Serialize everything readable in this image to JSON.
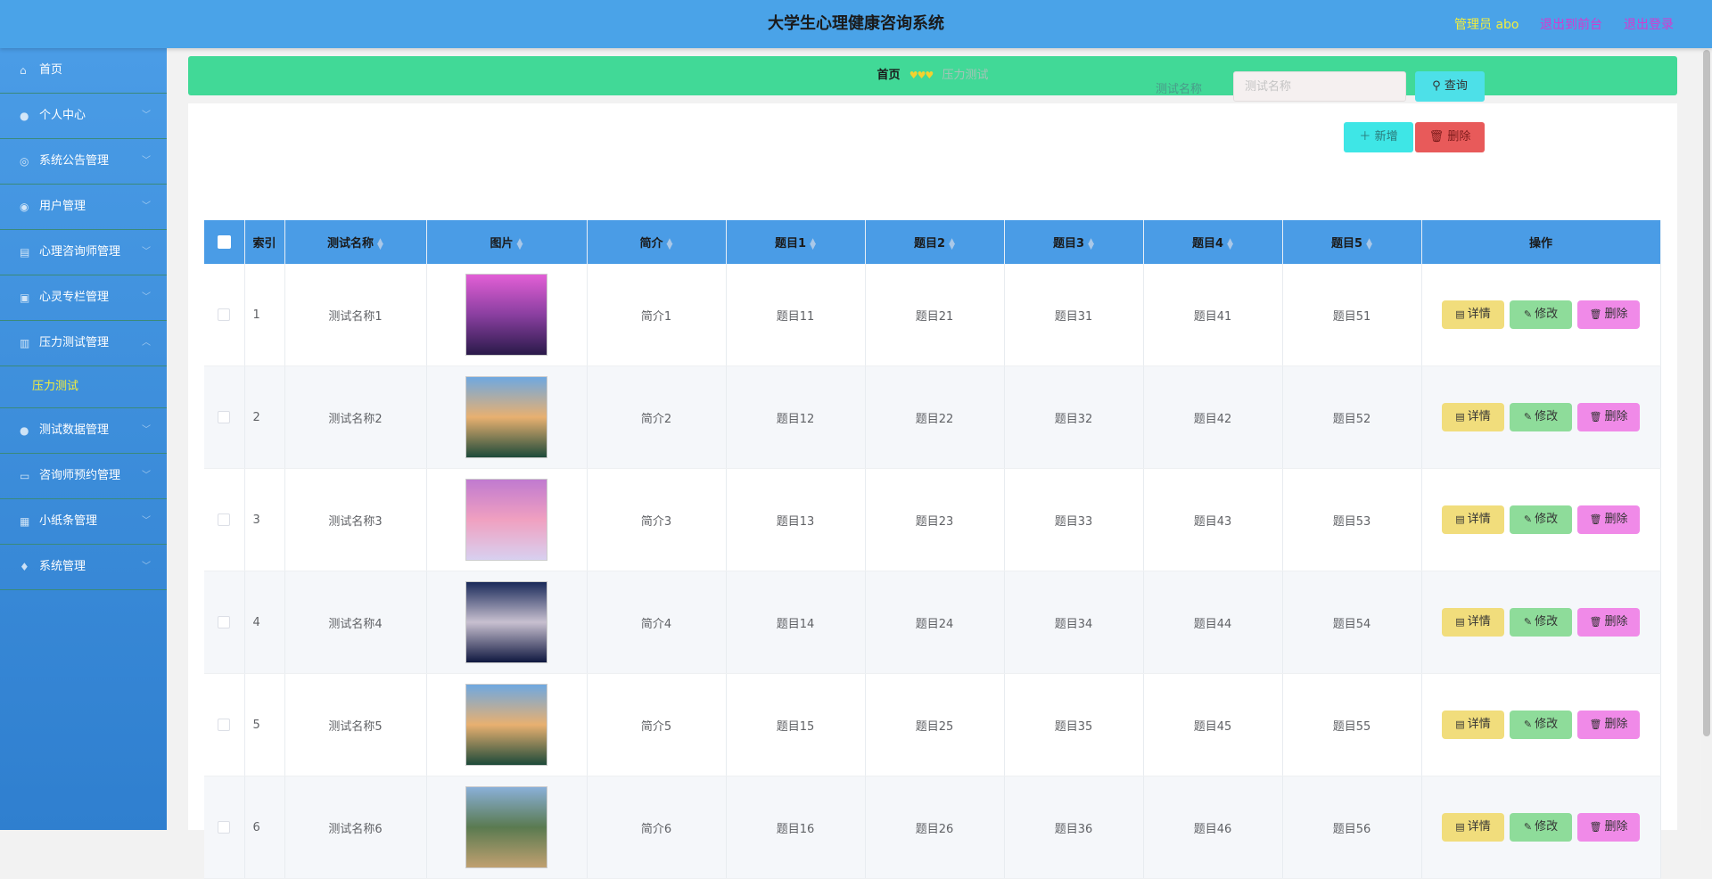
{
  "header": {
    "title": "大学生心理健康咨询系统",
    "admin_label": "管理员 abo",
    "front_link": "退出到前台",
    "logout_link": "退出登录"
  },
  "sidebar": {
    "items": [
      {
        "label": "首页",
        "icon": "home-icon",
        "has_chevron": false
      },
      {
        "label": "个人中心",
        "icon": "user-icon",
        "has_chevron": true
      },
      {
        "label": "系统公告管理",
        "icon": "globe-icon",
        "has_chevron": true
      },
      {
        "label": "用户管理",
        "icon": "compass-icon",
        "has_chevron": true
      },
      {
        "label": "心理咨询师管理",
        "icon": "chart-icon",
        "has_chevron": true
      },
      {
        "label": "心灵专栏管理",
        "icon": "briefcase-icon",
        "has_chevron": true
      },
      {
        "label": "压力测试管理",
        "icon": "clipboard-icon",
        "has_chevron": true,
        "expanded": true
      }
    ],
    "submenu": {
      "label": "压力测试"
    },
    "items_after": [
      {
        "label": "测试数据管理",
        "icon": "user-icon",
        "has_chevron": true
      },
      {
        "label": "咨询师预约管理",
        "icon": "monitor-icon",
        "has_chevron": true
      },
      {
        "label": "小纸条管理",
        "icon": "grid-icon",
        "has_chevron": true
      },
      {
        "label": "系统管理",
        "icon": "mic-icon",
        "has_chevron": true
      }
    ]
  },
  "breadcrumb": {
    "home": "首页",
    "current": "压力测试"
  },
  "search": {
    "label": "测试名称",
    "placeholder": "测试名称",
    "value": ""
  },
  "buttons": {
    "query": "查询",
    "add": "新增",
    "delete": "删除"
  },
  "table": {
    "columns": [
      "索引",
      "测试名称",
      "图片",
      "简介",
      "题目1",
      "题目2",
      "题目3",
      "题目4",
      "题目5",
      "操作"
    ],
    "rows": [
      {
        "index": "1",
        "name": "测试名称1",
        "intro": "简介1",
        "q1": "题目11",
        "q2": "题目21",
        "q3": "题目31",
        "q4": "题目41",
        "q5": "题目51",
        "image_colors": [
          "#e25fd6",
          "#8a3fa0",
          "#2a1a4a"
        ]
      },
      {
        "index": "2",
        "name": "测试名称2",
        "intro": "简介2",
        "q1": "题目12",
        "q2": "题目22",
        "q3": "题目32",
        "q4": "题目42",
        "q5": "题目52",
        "image_colors": [
          "#6fa8e0",
          "#e8b070",
          "#1e4a3a"
        ]
      },
      {
        "index": "3",
        "name": "测试名称3",
        "intro": "简介3",
        "q1": "题目13",
        "q2": "题目23",
        "q3": "题目33",
        "q4": "题目43",
        "q5": "题目53",
        "image_colors": [
          "#c07ad0",
          "#f0a0c0",
          "#d8d0f0"
        ]
      },
      {
        "index": "4",
        "name": "测试名称4",
        "intro": "简介4",
        "q1": "题目14",
        "q2": "题目24",
        "q3": "题目34",
        "q4": "题目44",
        "q5": "题目54",
        "image_colors": [
          "#1a2a5a",
          "#c8c0d0",
          "#101840"
        ]
      },
      {
        "index": "5",
        "name": "测试名称5",
        "intro": "简介5",
        "q1": "题目15",
        "q2": "题目25",
        "q3": "题目35",
        "q4": "题目45",
        "q5": "题目55",
        "image_colors": [
          "#6fa8e0",
          "#e8b070",
          "#1e4a3a"
        ]
      },
      {
        "index": "6",
        "name": "测试名称6",
        "intro": "简介6",
        "q1": "题目16",
        "q2": "题目26",
        "q3": "题目36",
        "q4": "题目46",
        "q5": "题目56",
        "image_colors": [
          "#8ab0d8",
          "#5a7a50",
          "#c0a070"
        ]
      }
    ],
    "action_labels": {
      "detail": "详情",
      "edit": "修改",
      "delete": "删除"
    }
  },
  "colors": {
    "topbar": "#4aa3e8",
    "breadcrumb": "#41d997",
    "header_row": "#4a9ce6",
    "detail_btn": "#f1dd7c",
    "edit_btn": "#8edc9a",
    "delete_btn": "#f08ae8"
  }
}
